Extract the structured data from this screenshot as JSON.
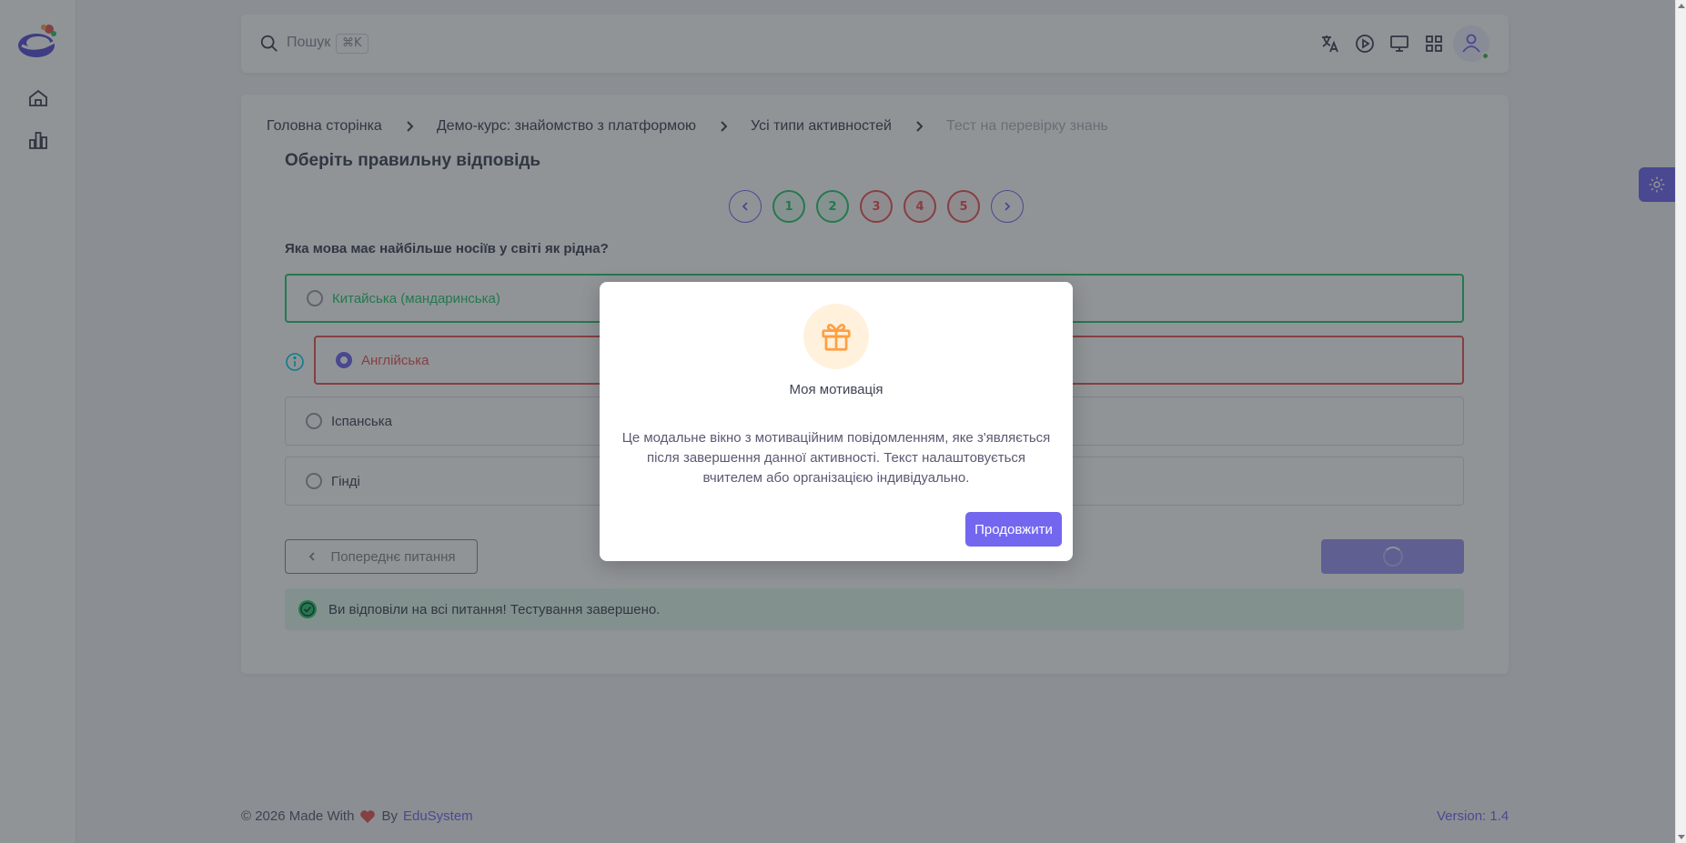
{
  "header": {
    "search_placeholder": "Пошук",
    "search_shortcut": "⌘K"
  },
  "breadcrumb": [
    "Головна сторінка",
    "Демо-курс: знайомство з платформою",
    "Усі типи активностей",
    "Тест на перевірку знань"
  ],
  "quiz": {
    "title": "Оберіть правильну відповідь",
    "pages": [
      "1",
      "2",
      "3",
      "4",
      "5"
    ],
    "question": "Яка мова має найбільше носіїв у світі як рідна?",
    "options": [
      "Китайська (мандаринська)",
      "Англійська",
      "Іспанська",
      "Гінді"
    ],
    "prev_button": "Попереднє питання",
    "completion_message": "Ви відповіли на всі питання! Тестування завершено."
  },
  "footer": {
    "copyright": "© 2026 Made With",
    "by": "By",
    "brand": "EduSystem",
    "version": "Version: 1.4"
  },
  "modal": {
    "title": "Моя мотивація",
    "body": "Це модальне вікно з мотиваційним повідомленням, яке з'являється після завершення данної активності. Текст налаштовується вчителем або організацією індивідуально.",
    "button": "Продовжити"
  },
  "colors": {
    "primary": "#7367f0",
    "success": "#28c76f",
    "danger": "#ea5455",
    "warning": "#ff9f43"
  }
}
